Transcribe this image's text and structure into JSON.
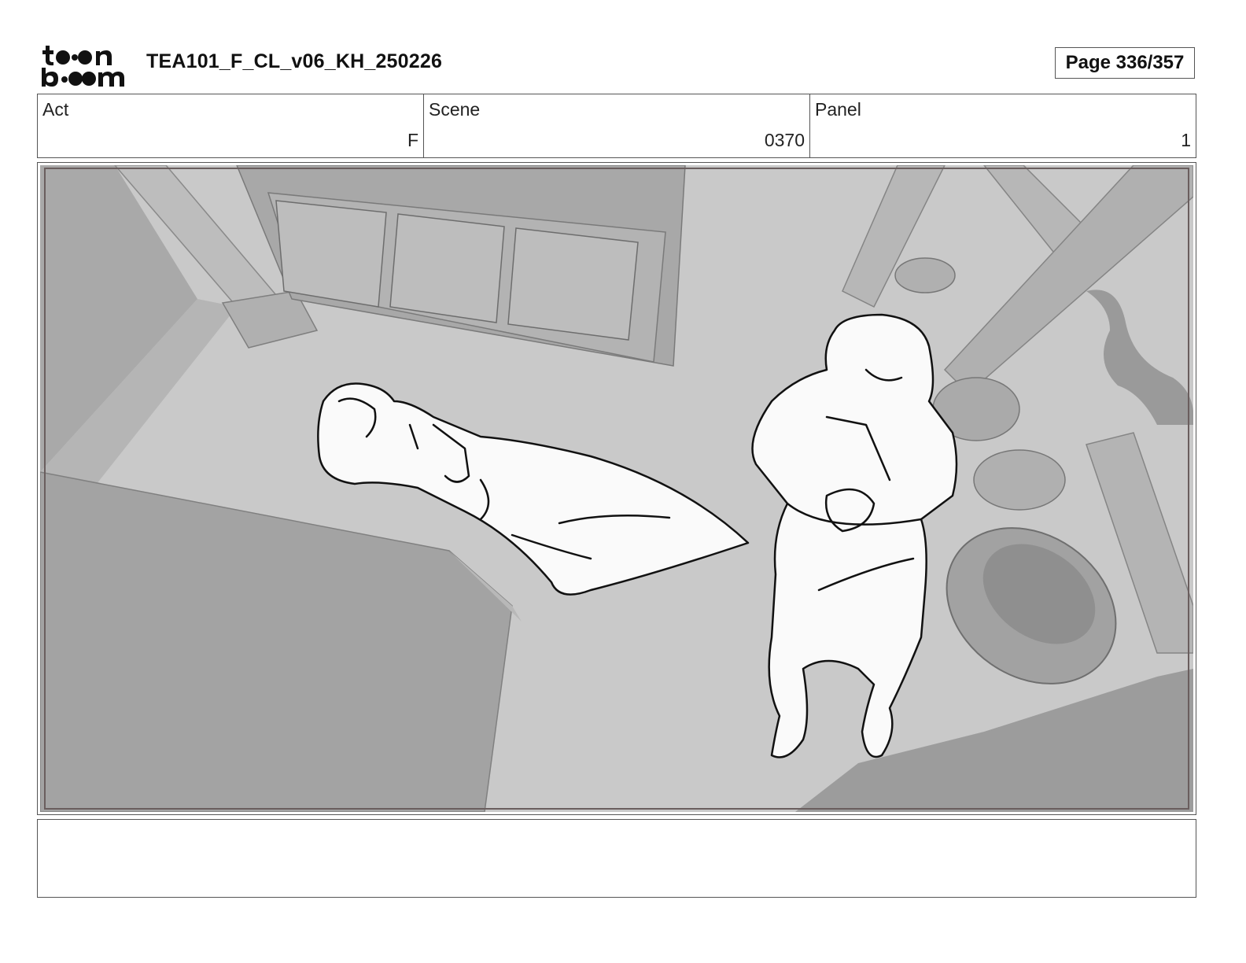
{
  "header": {
    "logo_text": "toon boom",
    "title": "TEA101_F_CL_v06_KH_250226",
    "page_label": "Page 336/357"
  },
  "meta": {
    "act": {
      "label": "Act",
      "value": "F"
    },
    "scene": {
      "label": "Scene",
      "value": "0370"
    },
    "panel": {
      "label": "Panel",
      "value": "1"
    }
  },
  "panel_image": {
    "description_icon": "storyboard-sketch-image"
  },
  "notes": {
    "text": ""
  }
}
